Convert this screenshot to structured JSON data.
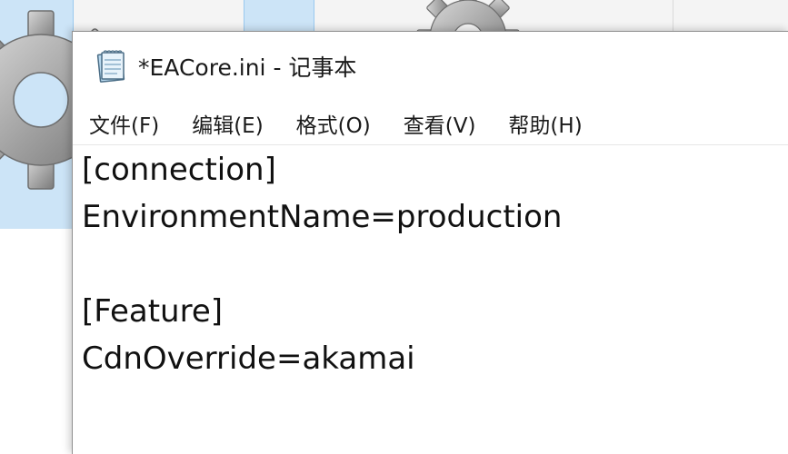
{
  "window": {
    "title": "*EACore.ini - 记事本",
    "app_icon": "notepad-icon"
  },
  "menu": [
    {
      "label": "文件(F)"
    },
    {
      "label": "编辑(E)"
    },
    {
      "label": "格式(O)"
    },
    {
      "label": "查看(V)"
    },
    {
      "label": "帮助(H)"
    }
  ],
  "editor": {
    "lines": [
      "[connection]",
      "EnvironmentName=production",
      "",
      "[Feature]",
      "CdnOverride=akamai"
    ]
  },
  "colors": {
    "selection_blue": "#cce4f7",
    "window_border": "#8f8f8f",
    "text": "#111111"
  },
  "background": {
    "icons": [
      "gear-icon",
      "gear-icon"
    ]
  }
}
